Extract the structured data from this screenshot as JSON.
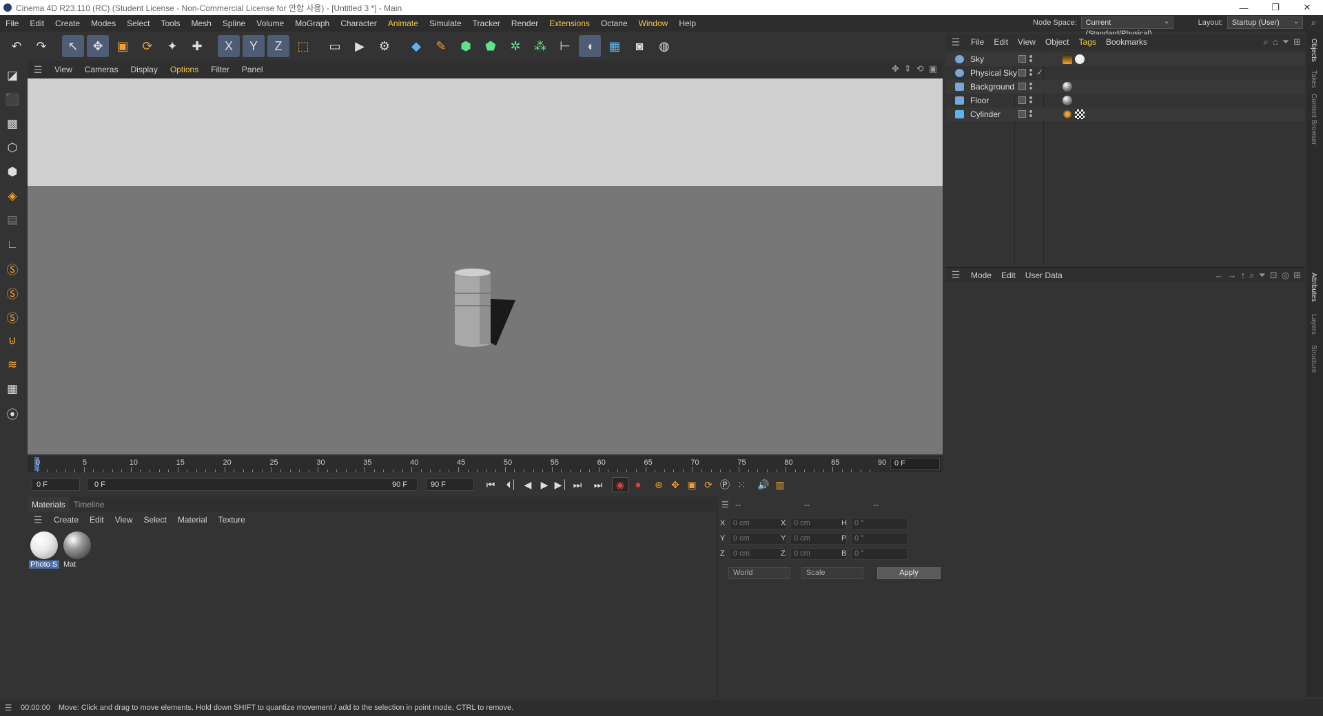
{
  "window": {
    "title": "Cinema 4D R23.110 (RC) (Student License - Non-Commercial License for 안함 사용) - [Untitled 3 *] - Main",
    "min_glyph": "—",
    "max_glyph": "❐",
    "close_glyph": "✕"
  },
  "menubar": {
    "items": [
      "File",
      "Edit",
      "Create",
      "Modes",
      "Select",
      "Tools",
      "Mesh",
      "Spline",
      "Volume",
      "MoGraph",
      "Character",
      "Animate",
      "Simulate",
      "Tracker",
      "Render",
      "Extensions",
      "Octane",
      "Window",
      "Help"
    ],
    "highlighted": [
      "Animate",
      "Extensions",
      "Window"
    ],
    "node_space_label": "Node Space:",
    "node_space_value": "Current (Standard/Physical)",
    "layout_label": "Layout:",
    "layout_value": "Startup (User)"
  },
  "toolbar": {
    "tools": [
      {
        "name": "undo-icon",
        "glyph": "↶"
      },
      {
        "name": "redo-icon",
        "glyph": "↷"
      },
      {
        "name": "select-icon",
        "glyph": "↖"
      },
      {
        "name": "move-icon",
        "glyph": "✥"
      },
      {
        "name": "scale-icon",
        "glyph": "▣"
      },
      {
        "name": "rotate-icon",
        "glyph": "⟳"
      },
      {
        "name": "recent-tool-icon",
        "glyph": "✦"
      },
      {
        "name": "transform-icon",
        "glyph": "✚"
      },
      {
        "name": "x-axis-icon",
        "glyph": "X"
      },
      {
        "name": "y-axis-icon",
        "glyph": "Y"
      },
      {
        "name": "z-axis-icon",
        "glyph": "Z"
      },
      {
        "name": "coord-system-icon",
        "glyph": "⬚"
      },
      {
        "name": "render-view-icon",
        "glyph": "▭"
      },
      {
        "name": "render-picture-viewer-icon",
        "glyph": "▶"
      },
      {
        "name": "render-settings-icon",
        "glyph": "⚙"
      },
      {
        "name": "cube-icon",
        "glyph": "◆"
      },
      {
        "name": "pen-icon",
        "glyph": "✎"
      },
      {
        "name": "subdivision-icon",
        "glyph": "⬢"
      },
      {
        "name": "extrude-icon",
        "glyph": "⬟"
      },
      {
        "name": "cloner-icon",
        "glyph": "✲"
      },
      {
        "name": "mograph-icon",
        "glyph": "⁂"
      },
      {
        "name": "deformer-icon",
        "glyph": "⊢"
      },
      {
        "name": "field-icon",
        "glyph": "◖"
      },
      {
        "name": "floor-icon",
        "glyph": "▦"
      },
      {
        "name": "camera-icon",
        "glyph": "◙"
      },
      {
        "name": "light-icon",
        "glyph": "◍"
      }
    ]
  },
  "left_toolbar": {
    "tools": [
      {
        "name": "make-editable-icon",
        "glyph": "◪"
      },
      {
        "name": "model-mode-icon",
        "glyph": "⬛"
      },
      {
        "name": "texture-mode-icon",
        "glyph": "▩"
      },
      {
        "name": "points-mode-icon",
        "glyph": "⬡"
      },
      {
        "name": "edges-mode-icon",
        "glyph": "⬢"
      },
      {
        "name": "polygons-mode-icon",
        "glyph": "◈"
      },
      {
        "name": "uv-mode-icon",
        "glyph": "▤"
      },
      {
        "name": "axis-mode-icon",
        "glyph": "∟"
      },
      {
        "name": "snap-icon",
        "glyph": "Ⓢ"
      },
      {
        "name": "snap-settings-icon",
        "glyph": "Ⓢ"
      },
      {
        "name": "quantize-icon",
        "glyph": "Ⓢ"
      },
      {
        "name": "magnet-icon",
        "glyph": "⊍"
      },
      {
        "name": "workplane-icon",
        "glyph": "≋"
      },
      {
        "name": "grid-icon",
        "glyph": "▦"
      },
      {
        "name": "lock-workplane-icon",
        "glyph": "⦿"
      }
    ]
  },
  "viewport": {
    "menu": [
      "View",
      "Cameras",
      "Display",
      "Options",
      "Filter",
      "Panel"
    ],
    "highlighted": [
      "Options"
    ],
    "colors": {
      "sky": "#cfcfcf",
      "floor": "#777777",
      "object": "#a8a8a8",
      "shadow": "#1a1a1a"
    }
  },
  "timeline": {
    "ticks": [
      "0",
      "5",
      "10",
      "15",
      "20",
      "25",
      "30",
      "35",
      "40",
      "45",
      "50",
      "55",
      "60",
      "65",
      "70",
      "75",
      "80",
      "85",
      "90"
    ],
    "current_frame": "0 F",
    "start_field": "0 F",
    "range_start": "0 F",
    "range_end": "90 F",
    "end_field": "90 F"
  },
  "materials": {
    "tabs": [
      "Materials",
      "Timeline"
    ],
    "menu": [
      "Create",
      "Edit",
      "View",
      "Select",
      "Material",
      "Texture"
    ],
    "items": [
      {
        "label": "Photo S",
        "selected": true
      },
      {
        "label": "Mat",
        "selected": false
      }
    ]
  },
  "coordinates": {
    "headers": [
      "--",
      "--",
      "--"
    ],
    "rows": [
      {
        "a": "X",
        "av": "0 cm",
        "b": "X",
        "bv": "0 cm",
        "c": "H",
        "cv": "0 °"
      },
      {
        "a": "Y",
        "av": "0 cm",
        "b": "Y",
        "bv": "0 cm",
        "c": "P",
        "cv": "0 °"
      },
      {
        "a": "Z",
        "av": "0 cm",
        "b": "Z",
        "bv": "0 cm",
        "c": "B",
        "cv": "0 °"
      }
    ],
    "space": "World",
    "mode": "Scale",
    "apply": "Apply"
  },
  "objects_panel": {
    "menu": [
      "File",
      "Edit",
      "View",
      "Object",
      "Tags",
      "Bookmarks"
    ],
    "highlighted": [
      "Tags"
    ],
    "objects": [
      {
        "name": "Sky",
        "icon": "sky-object-icon",
        "icon_color": "#7aa7d8",
        "checked": false
      },
      {
        "name": "Physical Sky",
        "icon": "physical-sky-icon",
        "icon_color": "#7aa7d8",
        "checked": true
      },
      {
        "name": "Background",
        "icon": "background-object-icon",
        "icon_color": "#7aa7d8",
        "checked": false
      },
      {
        "name": "Floor",
        "icon": "floor-object-icon",
        "icon_color": "#7aa7d8",
        "checked": false
      },
      {
        "name": "Cylinder",
        "icon": "cylinder-object-icon",
        "icon_color": "#5ab4f0",
        "checked": false
      }
    ]
  },
  "attributes_panel": {
    "menu": [
      "Mode",
      "Edit",
      "User Data"
    ]
  },
  "side_tabs": [
    "Objects",
    "Takes",
    "Content Browser",
    "Attributes",
    "Layers",
    "Structure"
  ],
  "status": {
    "time": "00:00:00",
    "message": "Move: Click and drag to move elements. Hold down SHIFT to quantize movement / add to the selection in point mode, CTRL to remove."
  }
}
